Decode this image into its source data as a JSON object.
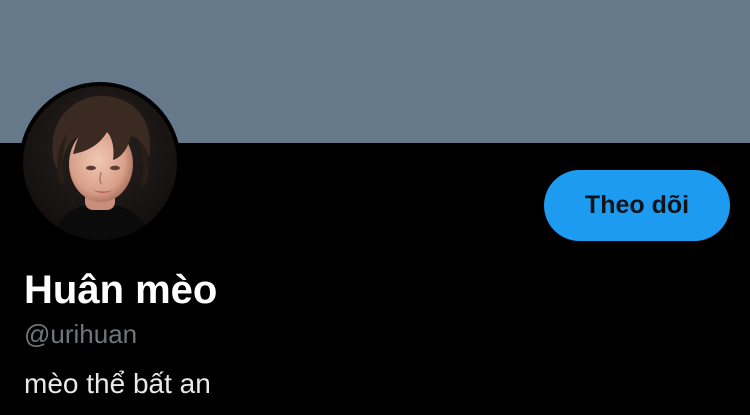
{
  "profile": {
    "banner_color": "#66798a",
    "avatar": "avatar-photo",
    "display_name": "Huân mèo",
    "handle": "@urihuan",
    "bio": "mèo thể bất an",
    "follow_button_label": "Theo dõi",
    "follow_button_color": "#1d9bf0"
  }
}
